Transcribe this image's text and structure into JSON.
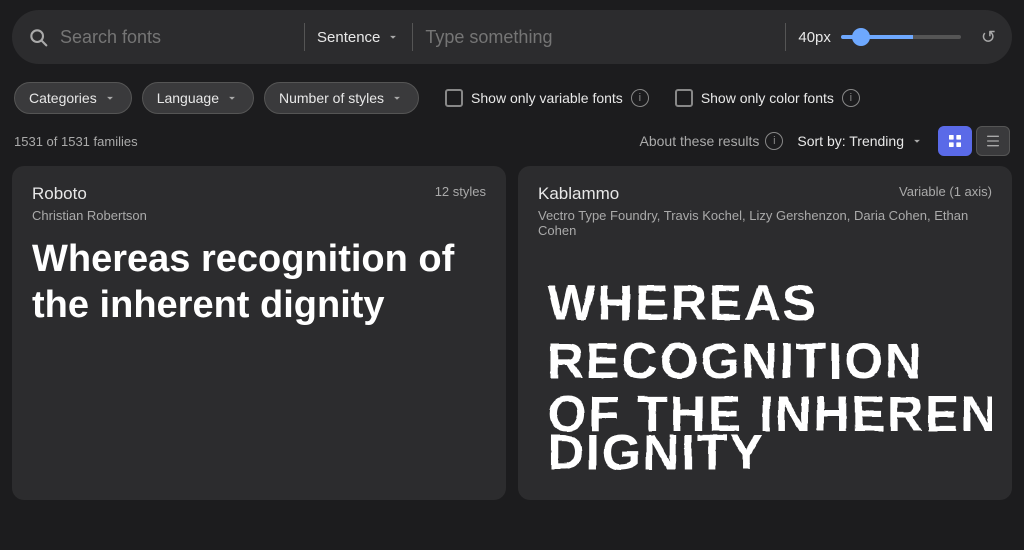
{
  "topbar": {
    "search_placeholder": "Search fonts",
    "sentence_label": "Sentence",
    "type_placeholder": "Type something",
    "px_label": "40px",
    "refresh_label": "↺"
  },
  "filters": {
    "categories_label": "Categories",
    "language_label": "Language",
    "num_styles_label": "Number of styles",
    "variable_fonts_label": "Show only variable fonts",
    "color_fonts_label": "Show only color fonts"
  },
  "results": {
    "count": "1531 of 1531 families",
    "about_label": "About these results",
    "sort_label": "Sort by: Trending"
  },
  "fonts": [
    {
      "name": "Roboto",
      "author": "Christian Robertson",
      "styles": "12 styles",
      "preview": "Whereas recognition of the inherent dignity"
    },
    {
      "name": "Kablammo",
      "author_full": "Vectro Type Foundry, Travis Kochel, Lizy Gershenzon, Daria Cohen, Ethan Cohen",
      "styles": "Variable (1 axis)",
      "preview": "WHEREAS RECOGNITION OF THE INHERENT DIGNITY"
    }
  ]
}
